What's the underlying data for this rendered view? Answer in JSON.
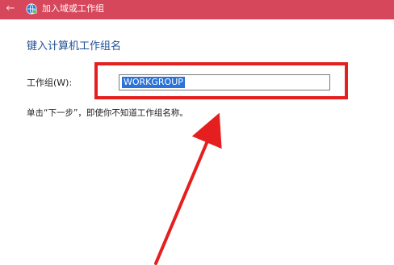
{
  "window": {
    "title": "加入域或工作组",
    "back_icon": "back-arrow-icon",
    "app_icon": "network-globe-icon"
  },
  "content": {
    "heading": "键入计算机工作组名",
    "workgroup_label": "工作组(W):",
    "workgroup_value": "WORKGROUP",
    "hint": "单击“下一步”，即使你不知道工作组名称。"
  },
  "colors": {
    "titlebar": "#d7475b",
    "heading": "#1f4f93",
    "selection": "#2a73d8",
    "annotation": "#e51f1f"
  }
}
